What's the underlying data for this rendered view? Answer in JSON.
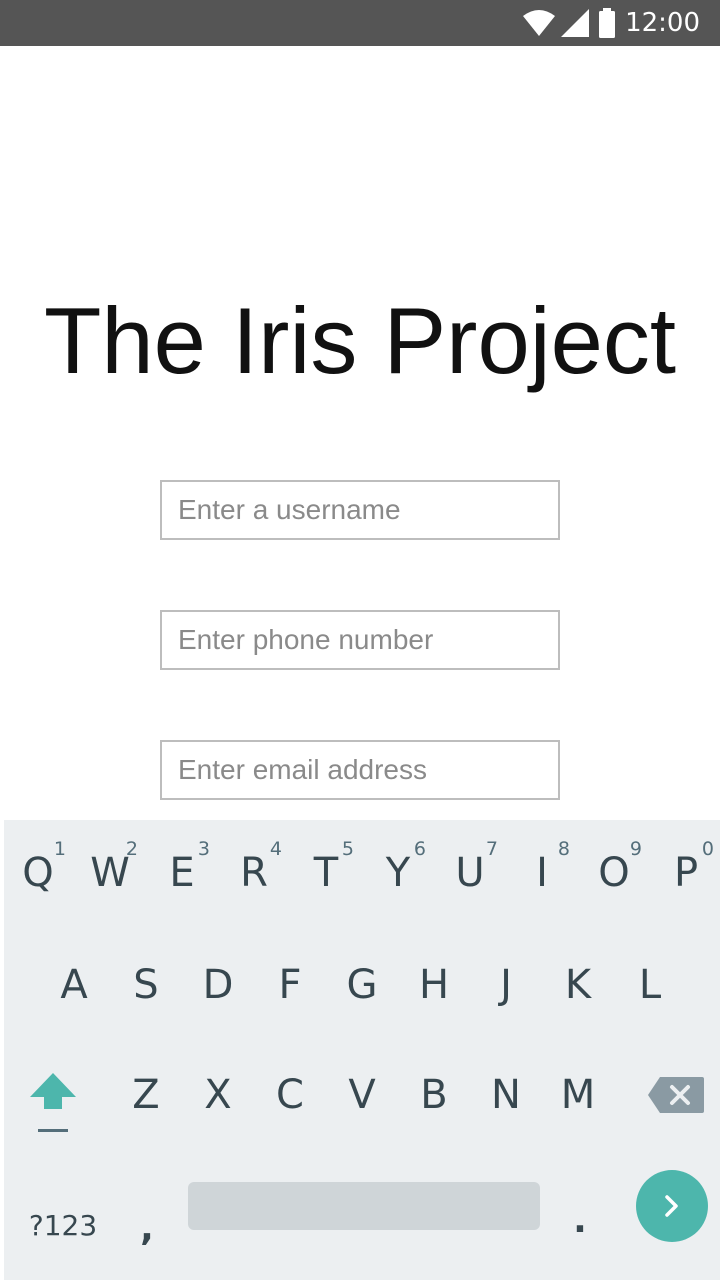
{
  "status_bar": {
    "time": "12:00",
    "icons": [
      "wifi-icon",
      "cell-signal-icon",
      "battery-icon"
    ],
    "background": "#555555"
  },
  "app": {
    "title": "The Iris Project"
  },
  "form": {
    "username_placeholder": "Enter a username",
    "username_value": "",
    "phone_placeholder": "Enter phone number",
    "phone_value": "",
    "email_placeholder": "Enter email address",
    "email_value": ""
  },
  "keyboard": {
    "row1": [
      {
        "label": "Q",
        "hint": "1"
      },
      {
        "label": "W",
        "hint": "2"
      },
      {
        "label": "E",
        "hint": "3"
      },
      {
        "label": "R",
        "hint": "4"
      },
      {
        "label": "T",
        "hint": "5"
      },
      {
        "label": "Y",
        "hint": "6"
      },
      {
        "label": "U",
        "hint": "7"
      },
      {
        "label": "I",
        "hint": "8"
      },
      {
        "label": "O",
        "hint": "9"
      },
      {
        "label": "P",
        "hint": "0"
      }
    ],
    "row2": [
      "A",
      "S",
      "D",
      "F",
      "G",
      "H",
      "J",
      "K",
      "L"
    ],
    "row3": [
      "Z",
      "X",
      "C",
      "V",
      "B",
      "N",
      "M"
    ],
    "symbols_label": "?123",
    "comma_label": ",",
    "period_label": ".",
    "accent_color": "#4db6ac",
    "background": "#eceff1"
  }
}
